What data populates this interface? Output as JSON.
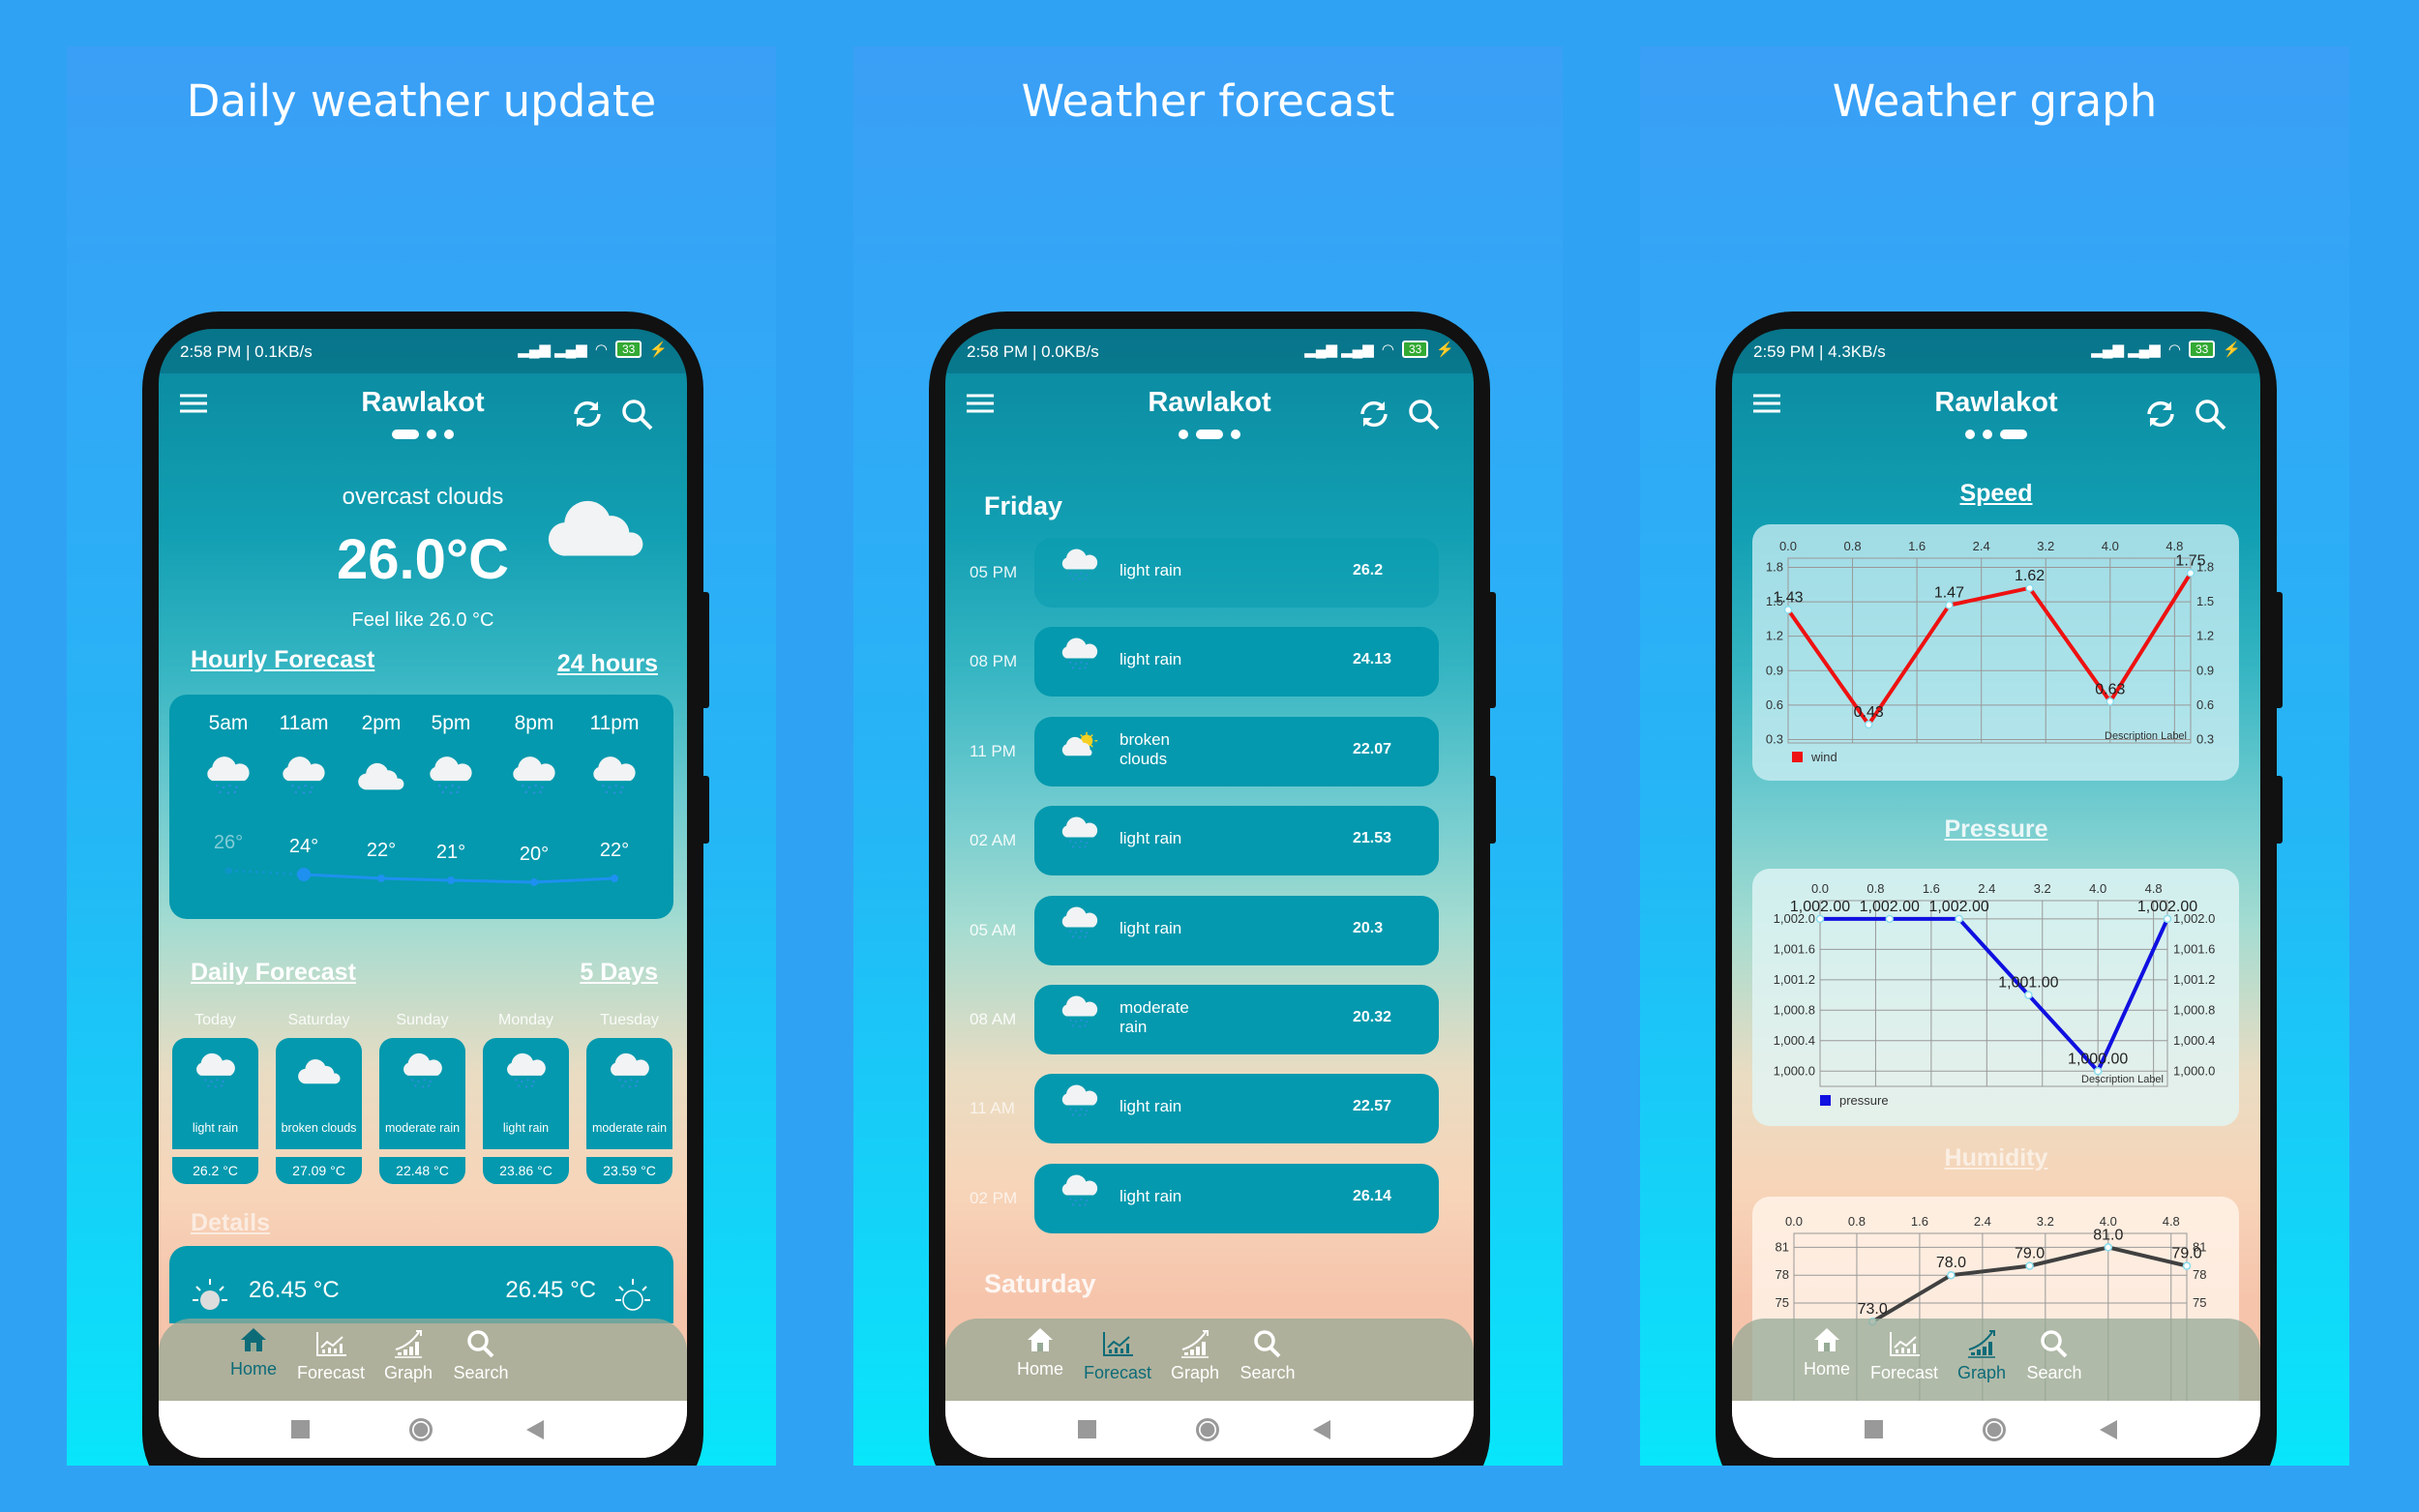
{
  "panels": [
    {
      "title": "Daily weather update"
    },
    {
      "title": "Weather forecast"
    },
    {
      "title": "Weather graph"
    }
  ],
  "phones": [
    {
      "status": {
        "time": "2:58 PM | 0.1KB/s",
        "battery": "33"
      },
      "city": "Rawlakot",
      "page_index": 0
    },
    {
      "status": {
        "time": "2:58 PM | 0.0KB/s",
        "battery": "33"
      },
      "city": "Rawlakot",
      "page_index": 1
    },
    {
      "status": {
        "time": "2:59 PM | 4.3KB/s",
        "battery": "33"
      },
      "city": "Rawlakot",
      "page_index": 2
    }
  ],
  "nav": {
    "items": [
      {
        "label": "Home",
        "icon": "home-icon"
      },
      {
        "label": "Forecast",
        "icon": "forecast-icon"
      },
      {
        "label": "Graph",
        "icon": "graph-icon"
      },
      {
        "label": "Search",
        "icon": "search-icon"
      }
    ]
  },
  "home": {
    "condition": "overcast clouds",
    "temperature": "26.0°C",
    "feels_like": "Feel like 26.0 °C",
    "hourly": {
      "title": "Hourly Forecast",
      "link": "24 hours",
      "items": [
        {
          "time": "5am",
          "temp": "26°",
          "value": 26,
          "icon": "rain-cloud-icon"
        },
        {
          "time": "11am",
          "temp": "24°",
          "value": 24,
          "icon": "rain-cloud-icon"
        },
        {
          "time": "2pm",
          "temp": "22°",
          "value": 22,
          "icon": "cloud-icon"
        },
        {
          "time": "5pm",
          "temp": "21°",
          "value": 21,
          "icon": "rain-cloud-icon"
        },
        {
          "time": "8pm",
          "temp": "20°",
          "value": 20,
          "icon": "rain-cloud-icon"
        },
        {
          "time": "11pm",
          "temp": "22°",
          "value": 22,
          "icon": "rain-cloud-icon"
        }
      ]
    },
    "daily": {
      "title": "Daily Forecast",
      "link": "5 Days",
      "items": [
        {
          "day": "Today",
          "desc": "light rain",
          "temp": "26.2 °C",
          "icon": "rain-cloud-icon"
        },
        {
          "day": "Saturday",
          "desc": "broken clouds",
          "temp": "27.09 °C",
          "icon": "cloud-icon"
        },
        {
          "day": "Sunday",
          "desc": "moderate rain",
          "temp": "22.48 °C",
          "icon": "rain-cloud-icon"
        },
        {
          "day": "Monday",
          "desc": "light rain",
          "temp": "23.86 °C",
          "icon": "rain-cloud-icon"
        },
        {
          "day": "Tuesday",
          "desc": "moderate rain",
          "temp": "23.59 °C",
          "icon": "rain-cloud-icon"
        }
      ]
    },
    "details": {
      "title": "Details",
      "sunrise_temp": "26.45 °C",
      "sunset_temp": "26.45 °C"
    }
  },
  "forecast": {
    "day": "Friday",
    "next_day": "Saturday",
    "rows": [
      {
        "time": "05 PM",
        "desc": "light rain",
        "temp": "26.2",
        "icon": "rain-cloud-icon"
      },
      {
        "time": "08 PM",
        "desc": "light rain",
        "temp": "24.13",
        "icon": "rain-cloud-icon"
      },
      {
        "time": "11 PM",
        "desc": "broken clouds",
        "temp": "22.07",
        "icon": "sun-cloud-icon"
      },
      {
        "time": "02 AM",
        "desc": "light rain",
        "temp": "21.53",
        "icon": "rain-cloud-icon"
      },
      {
        "time": "05 AM",
        "desc": "light rain",
        "temp": "20.3",
        "icon": "rain-cloud-icon"
      },
      {
        "time": "08 AM",
        "desc": "moderate rain",
        "temp": "20.32",
        "icon": "rain-cloud-icon"
      },
      {
        "time": "11 AM",
        "desc": "light rain",
        "temp": "22.57",
        "icon": "rain-cloud-icon"
      },
      {
        "time": "02 PM",
        "desc": "light rain",
        "temp": "26.14",
        "icon": "rain-cloud-icon"
      }
    ]
  },
  "colors": {
    "card": "#0499ae",
    "wind": "#ee1111",
    "pressure": "#1010e0",
    "humidity": "#404040",
    "active_nav": "#0d6b78"
  },
  "chart_data": [
    {
      "type": "line",
      "title": "Speed",
      "x": [
        0,
        1,
        2,
        3,
        4,
        5
      ],
      "values": [
        1.43,
        0.43,
        1.47,
        1.62,
        0.63,
        1.75
      ],
      "labels": [
        "1.43",
        "0.43",
        "1.47",
        "1.62",
        "0.63",
        "1.75"
      ],
      "xticks": [
        "0.0",
        "0.8",
        "1.6",
        "2.4",
        "3.2",
        "4.0",
        "4.8"
      ],
      "yticks": [
        "0.3",
        "0.6",
        "0.9",
        "1.2",
        "1.5",
        "1.8"
      ],
      "yvals": [
        0.3,
        0.6,
        0.9,
        1.2,
        1.5,
        1.8
      ],
      "xlim": [
        0,
        5
      ],
      "ylim": [
        0.27,
        1.88
      ],
      "series_name": "wind",
      "color": "#ee1111",
      "description": "Description Label",
      "grid": true,
      "legend": "bottom-left"
    },
    {
      "type": "line",
      "title": "Pressure",
      "x": [
        0,
        1,
        2,
        3,
        4,
        5
      ],
      "values": [
        1002,
        1002,
        1002,
        1001,
        1000,
        1002
      ],
      "labels": [
        "1,002.00",
        "1,002.00",
        "1,002.00",
        "1,001.00",
        "1,000.00",
        "1,002.00"
      ],
      "xticks": [
        "0.0",
        "0.8",
        "1.6",
        "2.4",
        "3.2",
        "4.0",
        "4.8"
      ],
      "yticks": [
        "1,000.0",
        "1,000.4",
        "1,000.8",
        "1,001.2",
        "1,001.6",
        "1,002.0"
      ],
      "yvals": [
        1000,
        1000.4,
        1000.8,
        1001.2,
        1001.6,
        1002
      ],
      "xlim": [
        0,
        5
      ],
      "ylim": [
        999.8,
        1002.24
      ],
      "series_name": "pressure",
      "color": "#1010e0",
      "description": "Description Label",
      "grid": true,
      "legend": "bottom-left"
    },
    {
      "type": "line",
      "title": "Humidity",
      "x": [
        1,
        2,
        3,
        4,
        5
      ],
      "values": [
        73,
        78,
        79,
        81,
        79
      ],
      "labels": [
        "73.0",
        "78.0",
        "79.0",
        "81.0",
        "79.0"
      ],
      "xticks": [
        "0.0",
        "0.8",
        "1.6",
        "2.4",
        "3.2",
        "4.0",
        "4.8"
      ],
      "yticks": [
        "75",
        "78",
        "81"
      ],
      "yvals": [
        75,
        78,
        81
      ],
      "xlim": [
        0,
        5
      ],
      "ylim": [
        62.5,
        82.5
      ],
      "color": "#404040",
      "grid": true
    }
  ]
}
